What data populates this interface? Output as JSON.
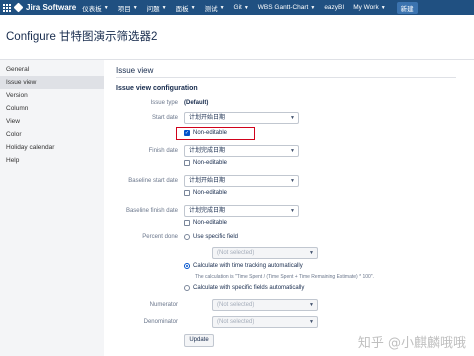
{
  "nav": {
    "logo": "Jira Software",
    "items": [
      "仪表板",
      "项目",
      "问题",
      "面板",
      "测试",
      "Git",
      "WBS Gantt-Chart",
      "eazyBI",
      "My Work"
    ],
    "new_button": "新建"
  },
  "page": {
    "title": "Configure 甘特图演示筛选器2"
  },
  "sidebar": {
    "items": [
      {
        "label": "General"
      },
      {
        "label": "Issue view"
      },
      {
        "label": "Version"
      },
      {
        "label": "Column"
      },
      {
        "label": "View"
      },
      {
        "label": "Color"
      },
      {
        "label": "Holiday calendar"
      },
      {
        "label": "Help"
      }
    ],
    "active": "Issue view"
  },
  "main": {
    "section_title": "Issue view",
    "config_title": "Issue view configuration",
    "issue_type": {
      "label": "Issue type",
      "value": "(Default)"
    },
    "start_date": {
      "label": "Start date",
      "selected": "计划开始日期",
      "non_editable_label": "Non-editable",
      "non_editable_checked": true
    },
    "finish_date": {
      "label": "Finish date",
      "selected": "计划完成日期",
      "non_editable_label": "Non-editable",
      "non_editable_checked": false
    },
    "baseline_start_date": {
      "label": "Baseline start date",
      "selected": "计划开始日期",
      "non_editable_label": "Non-editable",
      "non_editable_checked": false
    },
    "baseline_finish_date": {
      "label": "Baseline finish date",
      "selected": "计划完成日期",
      "non_editable_label": "Non-editable",
      "non_editable_checked": false
    },
    "percent_done": {
      "label": "Percent done",
      "option_specific": "Use specific field",
      "specific_placeholder": "(Not selected)",
      "option_time": "Calculate with time tracking automatically",
      "time_help": "The calculation is \"Time Spent / (Time Spent + Time Remaining Estimate) * 100\".",
      "option_fields": "Calculate with specific fields automatically",
      "selected": "option_time"
    },
    "numerator": {
      "label": "Numerator",
      "placeholder": "(Not selected)"
    },
    "denominator": {
      "label": "Denominator",
      "placeholder": "(Not selected)"
    },
    "update_button": "Update"
  },
  "watermark": "知乎 @小麒麟哦哦"
}
